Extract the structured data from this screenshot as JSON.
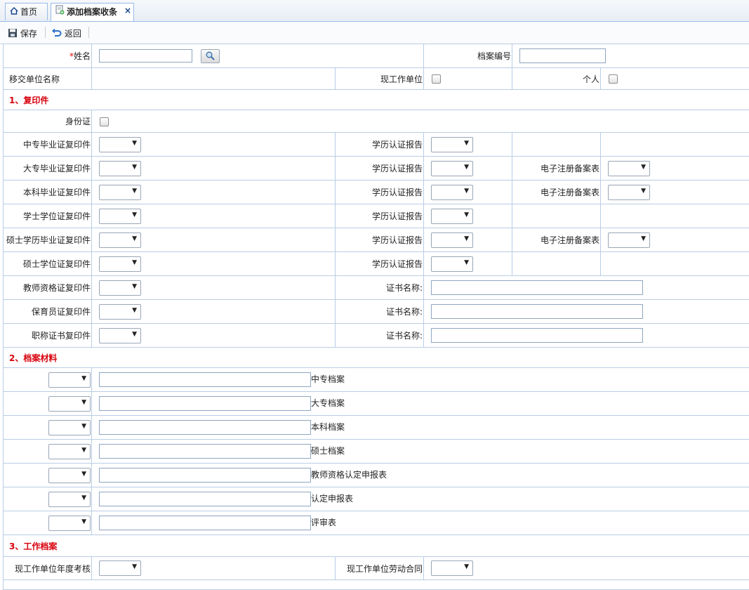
{
  "tabs": [
    {
      "label": "首页",
      "icon": "home-icon"
    },
    {
      "label": "添加档案收条",
      "icon": "page-add-icon",
      "close": "×"
    }
  ],
  "toolbar": {
    "save_label": "保存",
    "back_label": "返回"
  },
  "top": {
    "required_mark": "*",
    "name_label": "姓名",
    "name_value": "",
    "archive_no_label": "档案编号",
    "archive_no_value": "",
    "transfer_unit_label": "移交单位名称",
    "current_unit_label": "现工作单位",
    "personal_label": "个人"
  },
  "section1": {
    "title": "1、复印件",
    "id_card_label": "身份证",
    "rows": [
      {
        "label": "中专毕业证复印件",
        "mid": "学历认证报告",
        "right": ""
      },
      {
        "label": "大专毕业证复印件",
        "mid": "学历认证报告",
        "right": "电子注册备案表"
      },
      {
        "label": "本科毕业证复印件",
        "mid": "学历认证报告",
        "right": "电子注册备案表"
      },
      {
        "label": "学士学位证复印件",
        "mid": "学历认证报告",
        "right": ""
      },
      {
        "label": "硕士学历毕业证复印件",
        "mid": "学历认证报告",
        "right": "电子注册备案表"
      },
      {
        "label": "硕士学位证复印件",
        "mid": "学历认证报告",
        "right": ""
      }
    ],
    "cert_rows": [
      {
        "label": "教师资格证复印件",
        "cert_label": "证书名称:"
      },
      {
        "label": "保育员证复印件",
        "cert_label": "证书名称:"
      },
      {
        "label": "职称证书复印件",
        "cert_label": "证书名称:"
      }
    ]
  },
  "section2": {
    "title": "2、档案材料",
    "rows": [
      {
        "label": "中专档案"
      },
      {
        "label": "大专档案"
      },
      {
        "label": "本科档案"
      },
      {
        "label": "硕士档案"
      },
      {
        "label": "教师资格认定申报表"
      },
      {
        "label": "认定申报表"
      },
      {
        "label": "评审表"
      }
    ]
  },
  "section3": {
    "title": "3、工作档案",
    "annual_review_label": "现工作单位年度考核",
    "labor_contract_label": "现工作单位劳动合同"
  },
  "colors": {
    "section_title": "#d8000c",
    "border": "#b9cde5",
    "tab_border": "#99bbe8"
  }
}
